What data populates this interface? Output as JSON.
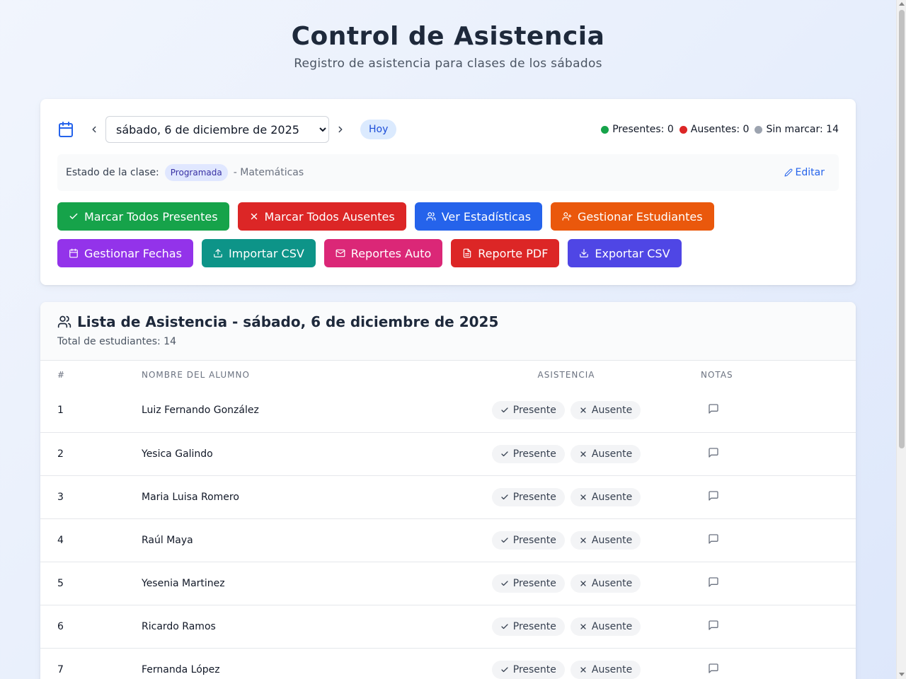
{
  "header": {
    "title": "Control de Asistencia",
    "subtitle": "Registro de asistencia para clases de los sábados"
  },
  "controls": {
    "date_selected": "sábado, 6 de diciembre de 2025",
    "today_label": "Hoy",
    "counts": {
      "present_label": "Presentes: 0",
      "absent_label": "Ausentes: 0",
      "unmarked_label": "Sin marcar: 14"
    },
    "status": {
      "label": "Estado de la clase:",
      "badge": "Programada",
      "subject": "- Matemáticas",
      "edit_label": "Editar"
    },
    "buttons_row1": [
      {
        "label": "Marcar Todos Presentes",
        "color": "#16a34a",
        "icon": "check-icon"
      },
      {
        "label": "Marcar Todos Ausentes",
        "color": "#dc2626",
        "icon": "x-icon"
      },
      {
        "label": "Ver Estadísticas",
        "color": "#2563eb",
        "icon": "users-icon"
      },
      {
        "label": "Gestionar Estudiantes",
        "color": "#ea580c",
        "icon": "user-plus-icon"
      }
    ],
    "buttons_row2": [
      {
        "label": "Gestionar Fechas",
        "color": "#9333ea",
        "icon": "calendar-icon"
      },
      {
        "label": "Importar CSV",
        "color": "#0d9488",
        "icon": "upload-icon"
      },
      {
        "label": "Reportes Auto",
        "color": "#db2777",
        "icon": "mail-icon"
      },
      {
        "label": "Reporte PDF",
        "color": "#dc2626",
        "icon": "file-icon"
      },
      {
        "label": "Exportar CSV",
        "color": "#4f46e5",
        "icon": "download-icon"
      }
    ]
  },
  "list": {
    "title": "Lista de Asistencia - sábado, 6 de diciembre de 2025",
    "total_label": "Total de estudiantes: 14",
    "columns": [
      "#",
      "Nombre del alumno",
      "Asistencia",
      "Notas"
    ],
    "present_label": "Presente",
    "absent_label": "Ausente",
    "rows": [
      {
        "num": "1",
        "name": "Luiz Fernando González"
      },
      {
        "num": "2",
        "name": "Yesica Galindo"
      },
      {
        "num": "3",
        "name": "Maria Luisa Romero"
      },
      {
        "num": "4",
        "name": "Raúl Maya"
      },
      {
        "num": "5",
        "name": "Yesenia Martinez"
      },
      {
        "num": "6",
        "name": "Ricardo Ramos"
      },
      {
        "num": "7",
        "name": "Fernanda López"
      }
    ]
  },
  "colors": {
    "present_dot": "#16a34a",
    "absent_dot": "#dc2626",
    "unmarked_dot": "#9ca3af"
  }
}
